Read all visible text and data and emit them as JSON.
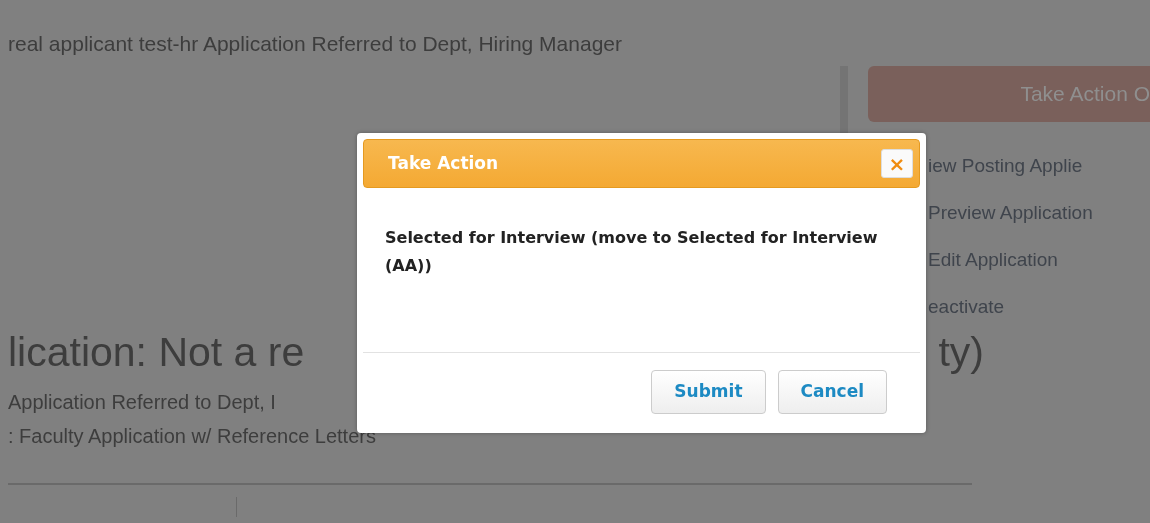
{
  "page": {
    "status_line": "real applicant test-hr Application Referred to Dept, Hiring Manager",
    "heading_left": "lication: Not a re",
    "heading_right": "ty)",
    "status_detail": "Application Referred to Dept, I",
    "form_line": ": Faculty Application w/ Reference Letters"
  },
  "sidebar": {
    "action_button": "Take Action O",
    "links": [
      "iew Posting Applie",
      "Preview Application",
      "Edit Application",
      "eactivate"
    ]
  },
  "modal": {
    "title": "Take Action",
    "close": "×",
    "message": "Selected for Interview (move to Selected for Interview (AA))",
    "buttons": [
      "Submit",
      "Cancel"
    ]
  }
}
